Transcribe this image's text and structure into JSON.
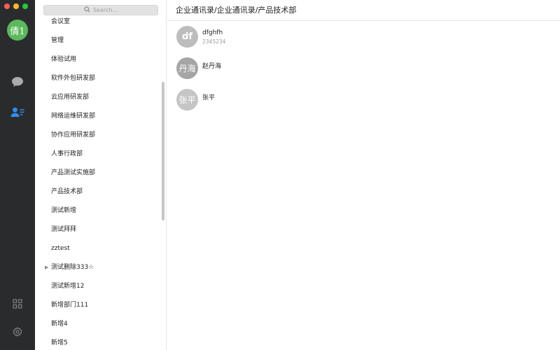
{
  "window": {
    "controls": [
      "close",
      "minimize",
      "maximize"
    ]
  },
  "rail": {
    "user_avatar_text": "倩1",
    "icons": [
      "chat-icon",
      "contacts-icon",
      "apps-icon",
      "settings-icon"
    ],
    "active": "contacts"
  },
  "search": {
    "placeholder": "Search..."
  },
  "departments": [
    {
      "label": "会议室",
      "has_children": false
    },
    {
      "label": "管理",
      "has_children": false
    },
    {
      "label": "体验试用",
      "has_children": false
    },
    {
      "label": "软件外包研发部",
      "has_children": false
    },
    {
      "label": "云应用研发部",
      "has_children": false
    },
    {
      "label": "网络运维研发部",
      "has_children": false
    },
    {
      "label": "协作应用研发部",
      "has_children": false
    },
    {
      "label": "人事行政部",
      "has_children": false
    },
    {
      "label": "产品测试实施部",
      "has_children": false
    },
    {
      "label": "产品技术部",
      "has_children": false
    },
    {
      "label": "测试新增",
      "has_children": false
    },
    {
      "label": "测试拜拜",
      "has_children": false
    },
    {
      "label": "zztest",
      "has_children": false
    },
    {
      "label": "测试删除333☆",
      "has_children": true
    },
    {
      "label": "测试新增12",
      "has_children": false
    },
    {
      "label": "新增部门111",
      "has_children": false
    },
    {
      "label": "新增4",
      "has_children": false
    },
    {
      "label": "新增5",
      "has_children": false
    }
  ],
  "breadcrumb": "企业通讯录/企业通讯录/产品技术部",
  "members": [
    {
      "avatar": "df",
      "name": "dfghfh",
      "sub": "2345234"
    },
    {
      "avatar": "丹海",
      "name": "赵丹海",
      "sub": ""
    },
    {
      "avatar": "张平",
      "name": "张平",
      "sub": ""
    }
  ]
}
